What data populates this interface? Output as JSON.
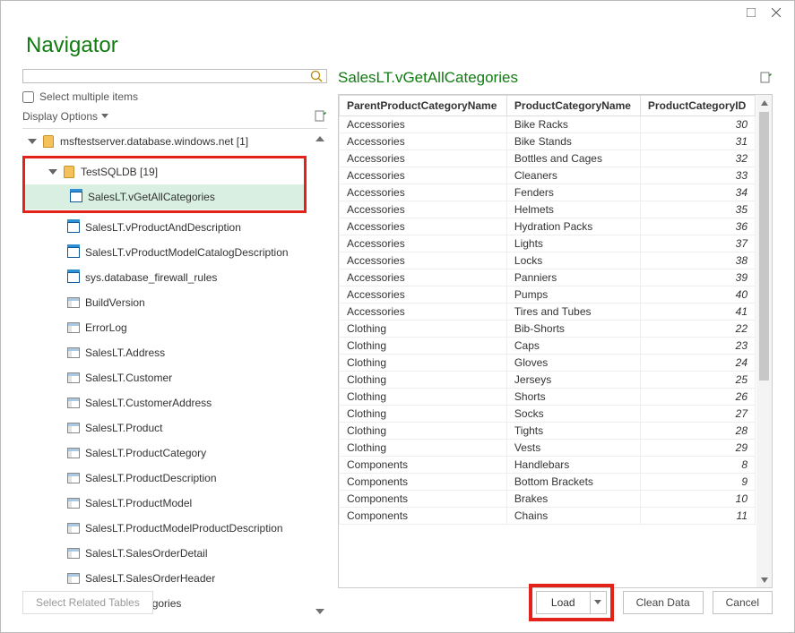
{
  "dialog": {
    "title": "Navigator"
  },
  "search": {
    "placeholder": ""
  },
  "select_multiple": "Select multiple items",
  "display_options": "Display Options",
  "tree": {
    "server": "msftestserver.database.windows.net [1]",
    "db": "TestSQLDB [19]",
    "items": [
      {
        "label": "SalesLT.vGetAllCategories",
        "type": "view",
        "selected": true
      },
      {
        "label": "SalesLT.vProductAndDescription",
        "type": "view"
      },
      {
        "label": "SalesLT.vProductModelCatalogDescription",
        "type": "view"
      },
      {
        "label": "sys.database_firewall_rules",
        "type": "view"
      },
      {
        "label": "BuildVersion",
        "type": "table"
      },
      {
        "label": "ErrorLog",
        "type": "table"
      },
      {
        "label": "SalesLT.Address",
        "type": "table"
      },
      {
        "label": "SalesLT.Customer",
        "type": "table"
      },
      {
        "label": "SalesLT.CustomerAddress",
        "type": "table"
      },
      {
        "label": "SalesLT.Product",
        "type": "table"
      },
      {
        "label": "SalesLT.ProductCategory",
        "type": "table"
      },
      {
        "label": "SalesLT.ProductDescription",
        "type": "table"
      },
      {
        "label": "SalesLT.ProductModel",
        "type": "table"
      },
      {
        "label": "SalesLT.ProductModelProductDescription",
        "type": "table"
      },
      {
        "label": "SalesLT.SalesOrderDetail",
        "type": "table"
      },
      {
        "label": "SalesLT.SalesOrderHeader",
        "type": "table"
      },
      {
        "label": "ufnGetAllCategories",
        "type": "fx"
      }
    ]
  },
  "preview": {
    "title": "SalesLT.vGetAllCategories",
    "headers": [
      "ParentProductCategoryName",
      "ProductCategoryName",
      "ProductCategoryID"
    ],
    "rows": [
      [
        "Accessories",
        "Bike Racks",
        "30"
      ],
      [
        "Accessories",
        "Bike Stands",
        "31"
      ],
      [
        "Accessories",
        "Bottles and Cages",
        "32"
      ],
      [
        "Accessories",
        "Cleaners",
        "33"
      ],
      [
        "Accessories",
        "Fenders",
        "34"
      ],
      [
        "Accessories",
        "Helmets",
        "35"
      ],
      [
        "Accessories",
        "Hydration Packs",
        "36"
      ],
      [
        "Accessories",
        "Lights",
        "37"
      ],
      [
        "Accessories",
        "Locks",
        "38"
      ],
      [
        "Accessories",
        "Panniers",
        "39"
      ],
      [
        "Accessories",
        "Pumps",
        "40"
      ],
      [
        "Accessories",
        "Tires and Tubes",
        "41"
      ],
      [
        "Clothing",
        "Bib-Shorts",
        "22"
      ],
      [
        "Clothing",
        "Caps",
        "23"
      ],
      [
        "Clothing",
        "Gloves",
        "24"
      ],
      [
        "Clothing",
        "Jerseys",
        "25"
      ],
      [
        "Clothing",
        "Shorts",
        "26"
      ],
      [
        "Clothing",
        "Socks",
        "27"
      ],
      [
        "Clothing",
        "Tights",
        "28"
      ],
      [
        "Clothing",
        "Vests",
        "29"
      ],
      [
        "Components",
        "Handlebars",
        "8"
      ],
      [
        "Components",
        "Bottom Brackets",
        "9"
      ],
      [
        "Components",
        "Brakes",
        "10"
      ],
      [
        "Components",
        "Chains",
        "11"
      ]
    ]
  },
  "buttons": {
    "select_related": "Select Related Tables",
    "load": "Load",
    "clean": "Clean Data",
    "cancel": "Cancel"
  }
}
